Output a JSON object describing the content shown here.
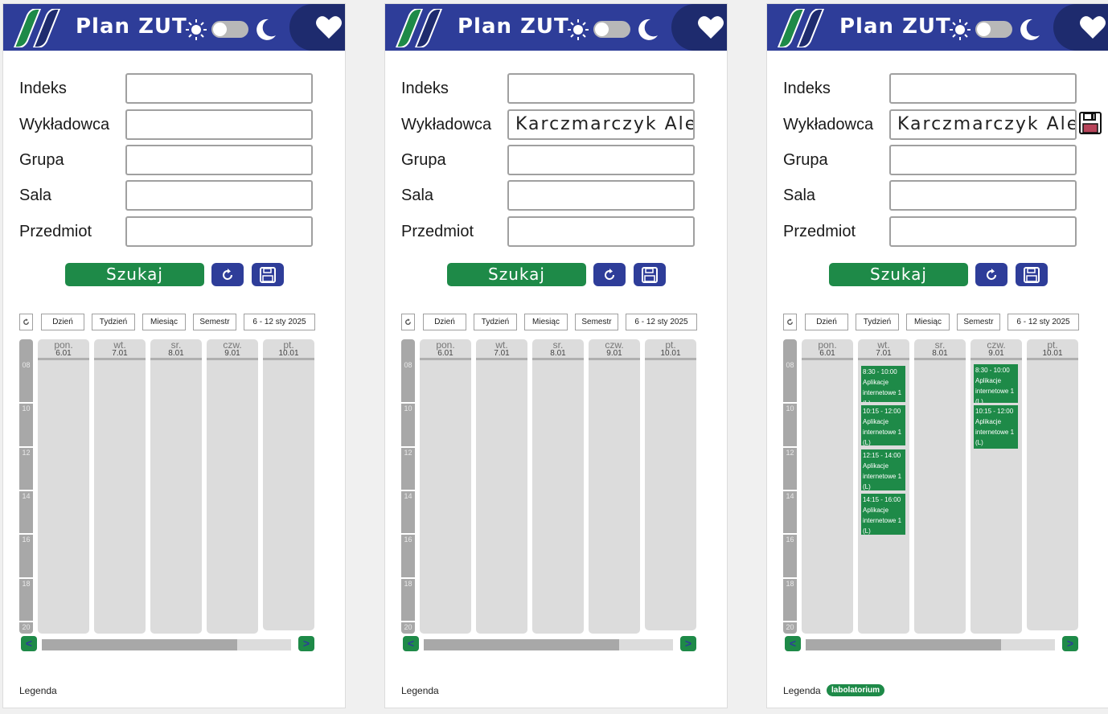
{
  "app": {
    "title": "Plan ZUT",
    "accent": "#2e3d99",
    "green": "#1e8a48"
  },
  "icons": {
    "logo": "zut-logo-icon",
    "sun": "sun-icon",
    "moon": "moon-icon",
    "heart": "heart-icon",
    "refresh": "refresh-icon",
    "save": "floppy-disk-icon"
  },
  "form": {
    "labels": {
      "index": "Indeks",
      "lecturer": "Wykładowca",
      "group": "Grupa",
      "room": "Sala",
      "subject": "Przedmiot"
    },
    "search_label": "Szukaj"
  },
  "panels": [
    {
      "lecturer_value": ""
    },
    {
      "lecturer_value": "Karczmarczyk Ale.."
    },
    {
      "lecturer_value": "Karczmarczyk Ale.."
    }
  ],
  "views": {
    "day": "Dzień",
    "week": "Tydzień",
    "month": "Miesiąc",
    "semester": "Semestr",
    "range": "6 - 12 sty 2025"
  },
  "hours": [
    "08",
    "10",
    "12",
    "14",
    "16",
    "18",
    "20"
  ],
  "days": [
    {
      "name": "pon.",
      "date": "6.01"
    },
    {
      "name": "wt.",
      "date": "7.01"
    },
    {
      "name": "sr.",
      "date": "8.01"
    },
    {
      "name": "czw.",
      "date": "9.01"
    },
    {
      "name": "pt.",
      "date": "10.01"
    }
  ],
  "events": {
    "tue": [
      {
        "time": "8:30 - 10:00",
        "title": "Aplikacje internetowe 1 (L)"
      },
      {
        "time": "10:15 - 12:00",
        "title": "Aplikacje internetowe 1 (L)"
      },
      {
        "time": "12:15 - 14:00",
        "title": "Aplikacje internetowe 1 (L)"
      },
      {
        "time": "14:15 - 16:00",
        "title": "Aplikacje internetowe 1 (L)"
      }
    ],
    "thu": [
      {
        "time": "8:30 - 10:00",
        "title": "Aplikacje internetowe 1 (L)"
      },
      {
        "time": "10:15 - 12:00",
        "title": "Aplikacje internetowe 1 (L)"
      }
    ]
  },
  "nav": {
    "prev": "<",
    "next": ">"
  },
  "legend": {
    "label": "Legenda",
    "lab_badge": "labolatorium"
  }
}
